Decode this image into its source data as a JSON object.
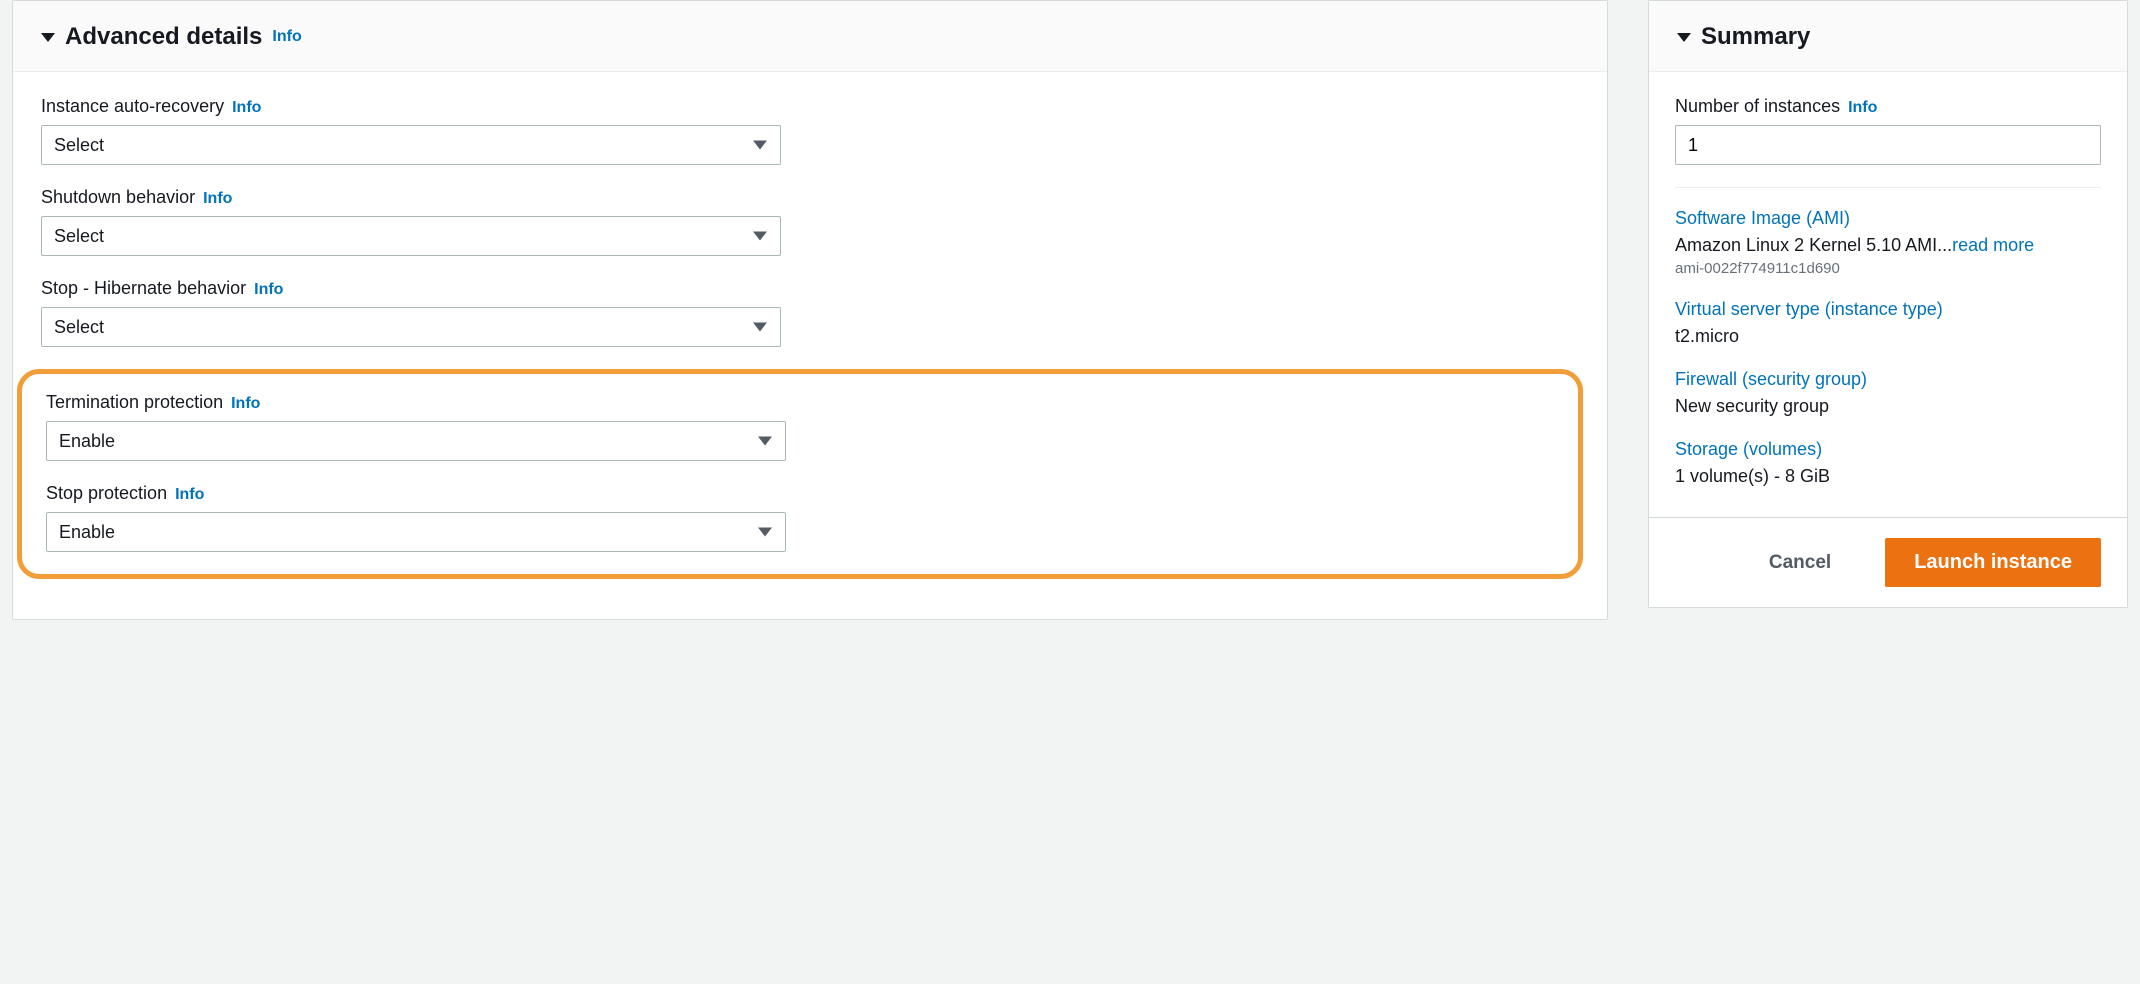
{
  "left_panel": {
    "title": "Advanced details",
    "info": "Info",
    "fields": {
      "auto_recovery": {
        "label": "Instance auto-recovery",
        "info": "Info",
        "value": "Select"
      },
      "shutdown_behavior": {
        "label": "Shutdown behavior",
        "info": "Info",
        "value": "Select"
      },
      "stop_hibernate": {
        "label": "Stop - Hibernate behavior",
        "info": "Info",
        "value": "Select"
      },
      "termination_protection": {
        "label": "Termination protection",
        "info": "Info",
        "value": "Enable"
      },
      "stop_protection": {
        "label": "Stop protection",
        "info": "Info",
        "value": "Enable"
      }
    }
  },
  "summary": {
    "title": "Summary",
    "num_instances": {
      "label": "Number of instances",
      "info": "Info",
      "value": "1"
    },
    "ami": {
      "link": "Software Image (AMI)",
      "value": "Amazon Linux 2 Kernel 5.10 AMI...",
      "readmore": "read more",
      "id": "ami-0022f774911c1d690"
    },
    "instance_type": {
      "link": "Virtual server type (instance type)",
      "value": "t2.micro"
    },
    "firewall": {
      "link": "Firewall (security group)",
      "value": "New security group"
    },
    "storage": {
      "link": "Storage (volumes)",
      "value": "1 volume(s) - 8 GiB"
    },
    "footer": {
      "cancel": "Cancel",
      "launch": "Launch instance"
    }
  }
}
